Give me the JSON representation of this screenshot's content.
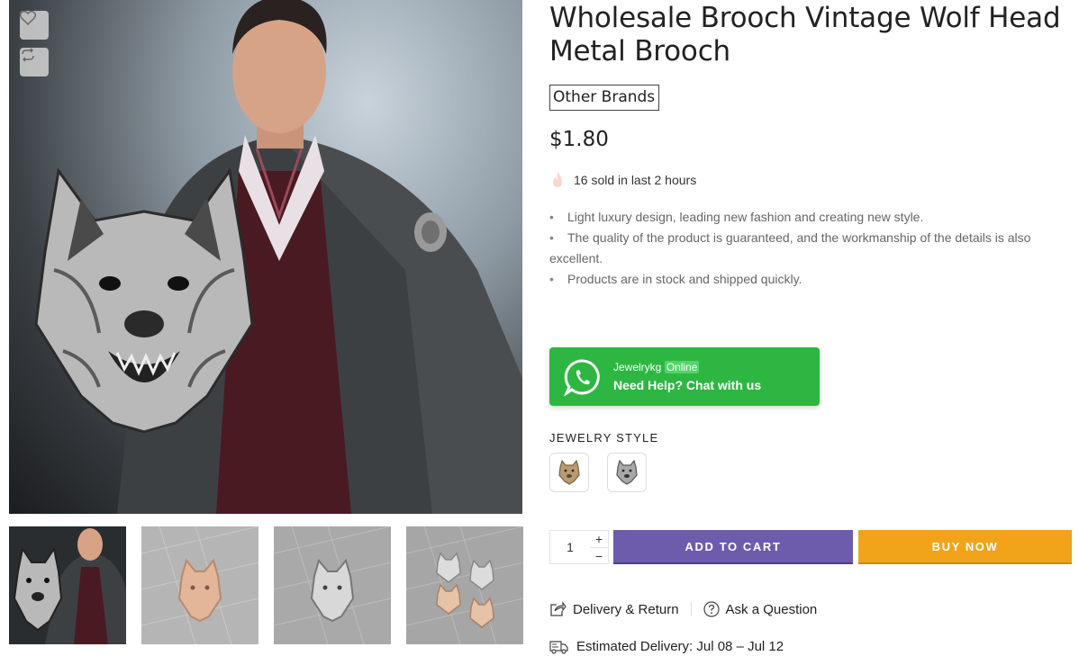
{
  "product": {
    "title": "Wholesale Brooch Vintage Wolf Head Metal Brooch",
    "brand": "Other Brands",
    "price": "$1.80",
    "sold_text": "16 sold in last 2 hours",
    "features": [
      "Light luxury design, leading new fashion and creating new style.",
      "The quality of the product is guaranteed, and the workmanship of the details is also excellent.",
      "Products are in stock and shipped quickly."
    ]
  },
  "gallery": {
    "icons": [
      "heart-icon",
      "compare-icon"
    ],
    "thumbnails": 4
  },
  "whatsapp": {
    "name": "Jewelrykg",
    "status": "Online",
    "help": "Need Help? Chat with us"
  },
  "variant": {
    "label": "JEWELRY STYLE",
    "options": [
      "gold",
      "silver"
    ]
  },
  "cart": {
    "quantity": "1",
    "plus": "+",
    "minus": "−",
    "add_to_cart": "ADD TO CART",
    "buy_now": "BUY NOW"
  },
  "links": {
    "delivery_return": "Delivery & Return",
    "ask_question": "Ask a Question"
  },
  "delivery": {
    "text": "Estimated Delivery: Jul 08 – Jul 12"
  },
  "colors": {
    "whatsapp": "#2db742",
    "add_to_cart": "#6c5cab",
    "buy_now": "#f1a31a"
  }
}
